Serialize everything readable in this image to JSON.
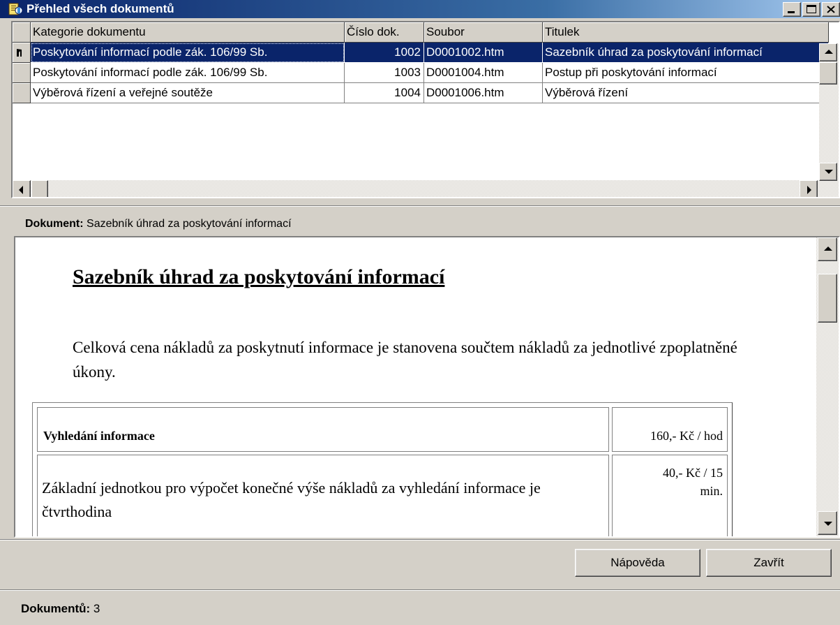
{
  "window": {
    "title": "Přehled všech dokumentů"
  },
  "grid": {
    "columns": [
      "Kategorie dokumentu",
      "Číslo dok.",
      "Soubor",
      "Titulek"
    ],
    "rows": [
      {
        "category": "Poskytování informací podle zák. 106/99 Sb.",
        "number": "1002",
        "file": "D0001002.htm",
        "title": "Sazebník úhrad za poskytování informací",
        "selected": true
      },
      {
        "category": "Poskytování informací podle zák. 106/99 Sb.",
        "number": "1003",
        "file": "D0001004.htm",
        "title": "Postup při poskytování informací",
        "selected": false
      },
      {
        "category": "Výběrová řízení a veřejné soutěže",
        "number": "1004",
        "file": "D0001006.htm",
        "title": "Výběrová řízení",
        "selected": false
      }
    ]
  },
  "document": {
    "label": "Dokument:",
    "current_title": "Sazebník úhrad za poskytování informací",
    "heading": "Sazebník úhrad za poskytování informací",
    "paragraph": "Celková cena nákladů za poskytnutí informace je stanovena součtem nákladů za jednotlivé zpoplatněné úkony.",
    "table": {
      "row1_label": "Vyhledání informace",
      "row1_value": "160,- Kč / hod",
      "row2_label": "Základní jednotkou pro výpočet konečné výše nákladů za vyhledání informace je čtvrthodina",
      "row2_value": "40,- Kč / 15 min."
    }
  },
  "buttons": {
    "help": "Nápověda",
    "close": "Zavřít"
  },
  "status": {
    "label": "Dokumentů:",
    "count": "3"
  }
}
